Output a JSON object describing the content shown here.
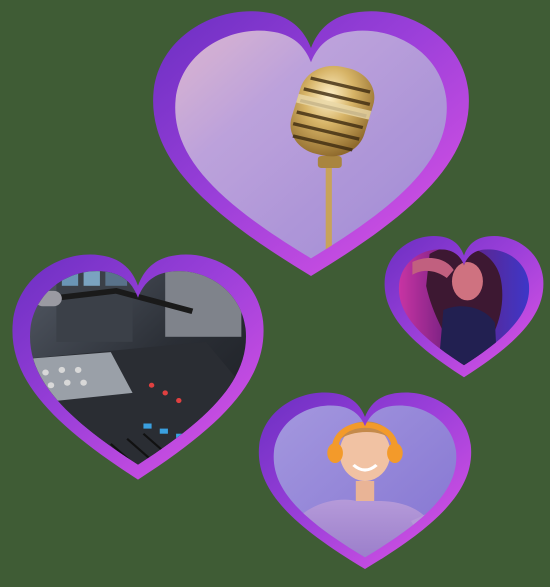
{
  "palette": {
    "background": "#3f5c35",
    "frame_pink": "#d44fe0",
    "frame_purple": "#8a3bd6",
    "frame_violet": "#6b2fc2"
  },
  "hearts": [
    {
      "id": "microphone",
      "depicts": "vintage-microphone-photo"
    },
    {
      "id": "singer",
      "depicts": "woman-in-neon-light-photo"
    },
    {
      "id": "mixer",
      "depicts": "studio-mixing-console-photo"
    },
    {
      "id": "listener",
      "depicts": "man-with-headphones-pointing-photo"
    }
  ]
}
